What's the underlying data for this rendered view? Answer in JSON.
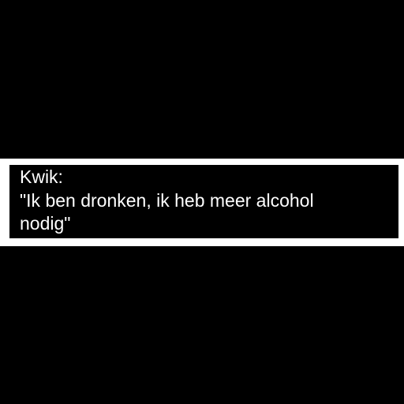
{
  "caption": {
    "speaker": "Kwik:",
    "quote_line1": "\"Ik ben dronken, ik heb meer alcohol",
    "quote_line2": "nodig\""
  },
  "colors": {
    "background": "#000000",
    "frame": "#ffffff",
    "text": "#ffffff"
  }
}
